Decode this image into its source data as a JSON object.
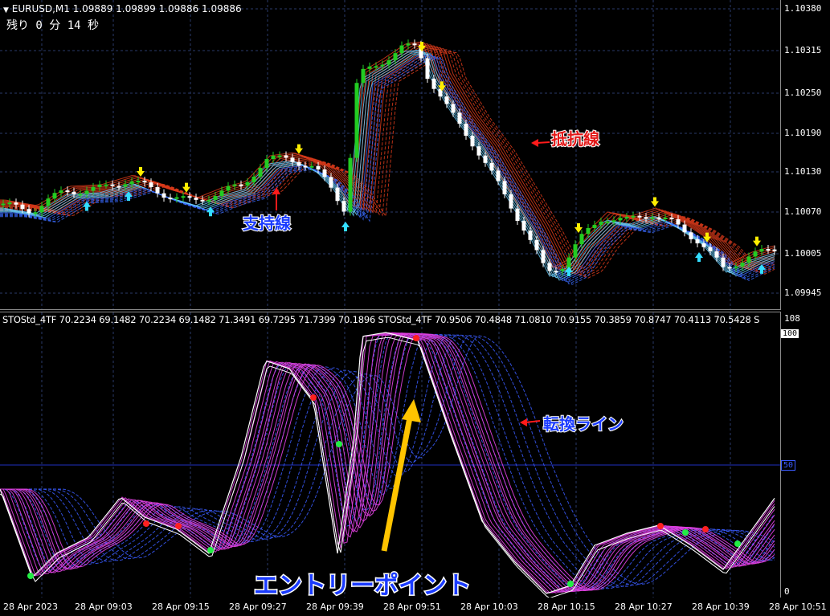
{
  "main": {
    "symbol_header": "EURUSD,M1  1.09889 1.09899 1.09886 1.09886",
    "timer": "残り  0 分 14 秒",
    "price_ticks": [
      "1.10380",
      "1.10315",
      "1.10250",
      "1.10190",
      "1.10130",
      "1.10070",
      "1.10005",
      "1.09945"
    ]
  },
  "indicator": {
    "header": "STOStd_4TF 70.2234 69.1482 70.2234 69.1482 71.3491 69.7295 71.7399 70.1896  STOStd_4TF 70.9506 70.4848 71.0810 70.9155 70.3859 70.8747 70.4113 70.5428  S",
    "top_scale": "108",
    "max_level": "100",
    "mid_level": "50",
    "min_level": "0"
  },
  "time_axis": [
    "28 Apr 2023",
    "28 Apr 09:03",
    "28 Apr 09:15",
    "28 Apr 09:27",
    "28 Apr 09:39",
    "28 Apr 09:51",
    "28 Apr 10:03",
    "28 Apr 10:15",
    "28 Apr 10:27",
    "28 Apr 10:39",
    "28 Apr 10:51"
  ],
  "annotations": {
    "support": "支持線",
    "resistance": "抵抗線",
    "switch_line": "転換ライン",
    "entry_point": "エントリーポイント"
  },
  "colors": {
    "bull": "#22cc22",
    "bear": "#ffffff",
    "up_arrow": "#33ddff",
    "down_arrow": "#ffee00",
    "resistance_band": "#d83a1a",
    "support_band": "#3a6aff",
    "stoch_fast": "#e040e0",
    "stoch_slow": "#3060ff"
  }
}
